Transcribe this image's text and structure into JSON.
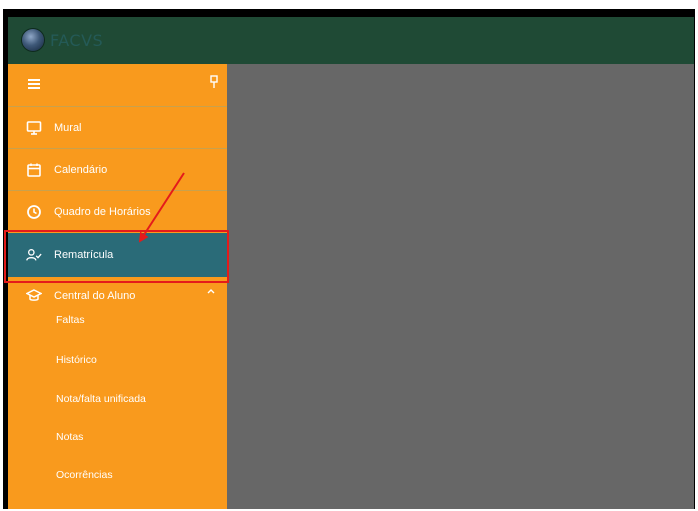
{
  "header": {
    "logo_text": "FACVS",
    "brand_color": "#1f4a35"
  },
  "sidebar": {
    "accent": "#f99a1d",
    "active_color": "#2a6b78",
    "items": [
      {
        "label": "Mural",
        "icon": "monitor-icon"
      },
      {
        "label": "Calendário",
        "icon": "calendar-icon"
      },
      {
        "label": "Quadro de Horários",
        "icon": "clock-icon"
      },
      {
        "label": "Rematrícula",
        "icon": "user-check-icon",
        "active": true
      },
      {
        "label": "Central do Aluno",
        "icon": "graduation-cap-icon",
        "expanded": true
      }
    ],
    "subitems": [
      "Faltas",
      "Histórico",
      "Nota/falta unificada",
      "Notas",
      "Ocorrências"
    ]
  },
  "annotation": {
    "highlight_color": "#e41b1b"
  }
}
